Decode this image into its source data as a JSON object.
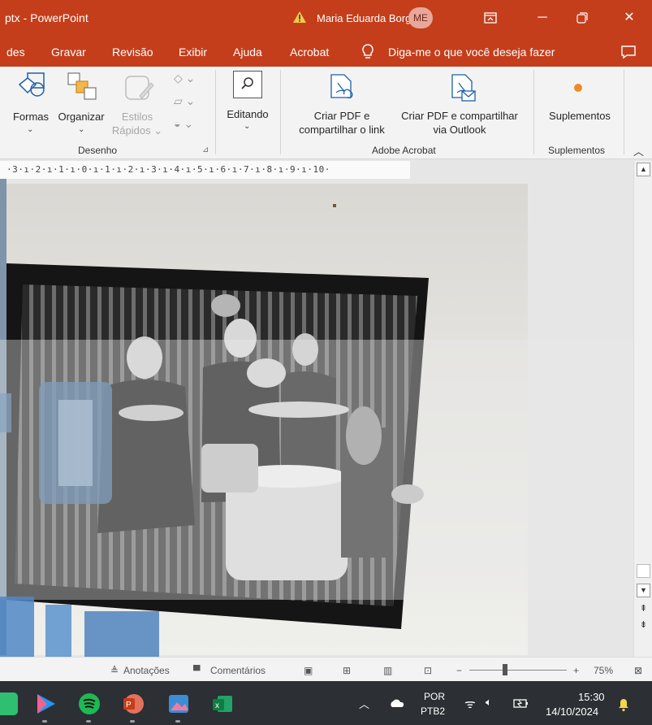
{
  "titlebar": {
    "title": "ptx  -  PowerPoint",
    "user": "Maria Eduarda Borges",
    "initials": "ME"
  },
  "menu": {
    "items": [
      "des",
      "Gravar",
      "Revisão",
      "Exibir",
      "Ajuda",
      "Acrobat"
    ],
    "tellme": "Diga-me o que você deseja fazer"
  },
  "ribbon": {
    "formas": "Formas",
    "organizar": "Organizar",
    "estilos_line1": "Estilos",
    "estilos_line2": "Rápidos",
    "editando": "Editando",
    "criar_pdf_line1": "Criar PDF e",
    "criar_pdf_line2": "compartilhar o link",
    "criar_outlook_line1": "Criar PDF e compartilhar",
    "criar_outlook_line2": "via Outlook",
    "suplementos": "Suplementos",
    "group_desenho": "Desenho",
    "group_acrobat": "Adobe Acrobat",
    "group_suplementos": "Suplementos"
  },
  "ruler": {
    "text": "·3·ı·2·ı·1·ı·0·ı·1·ı·2·ı·3·ı·4·ı·5·ı·6·ı·7·ı·8·ı·9·ı·10·"
  },
  "status": {
    "notes": "Anotações",
    "comments": "Comentários",
    "zoom": "75%"
  },
  "taskbar": {
    "lang_line1": "POR",
    "lang_line2": "PTB2",
    "time": "15:30",
    "date": "14/10/2024"
  },
  "colors": {
    "accent": "#c43e1c",
    "taskbar": "#2c2f33"
  }
}
